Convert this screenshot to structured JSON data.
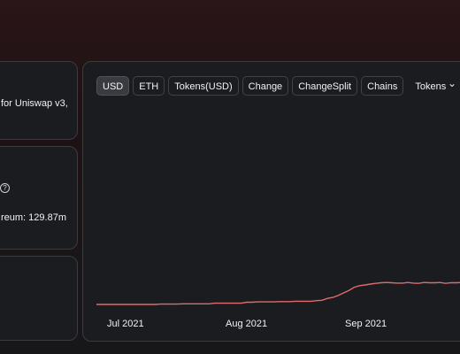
{
  "sidebar": {
    "card1_text_line1": "for Uniswap v3,",
    "card2_text": "reum: 129.87m",
    "info_icon": "?"
  },
  "tabs": [
    "USD",
    "ETH",
    "Tokens(USD)",
    "Change",
    "ChangeSplit",
    "Chains",
    "Tokens"
  ],
  "dropdown_icon": "chevron-down-icon",
  "chart_data": {
    "type": "line",
    "x_ticks": [
      "Jul 2021",
      "Aug 2021",
      "Sep 2021"
    ],
    "series": [
      {
        "values": [
          0,
          0,
          0,
          0,
          0,
          0,
          0,
          0,
          0,
          0,
          0,
          0,
          0.2,
          0.2,
          0.2,
          0.2,
          0.4,
          0.4,
          0.4,
          0.4,
          0.4,
          0.4,
          0.8,
          0.8,
          0.8,
          0.8,
          0.8,
          0.8,
          1.4,
          1.4,
          1.6,
          1.6,
          1.6,
          1.6,
          1.8,
          1.8,
          1.8,
          2,
          2,
          2,
          2,
          2.4,
          2.6,
          3.8,
          4.4,
          5.6,
          7.2,
          8.8,
          10.8,
          11.8,
          12.2,
          12.8,
          13.2,
          13.6,
          13.8,
          13.6,
          13.4,
          13.4,
          13.8,
          13.4,
          13.2,
          13.8,
          13.6,
          13.6,
          13.8,
          13.2,
          13.6,
          13.6,
          13.8,
          13.6,
          13.6
        ]
      }
    ],
    "line_color": "#dd6b6e"
  }
}
